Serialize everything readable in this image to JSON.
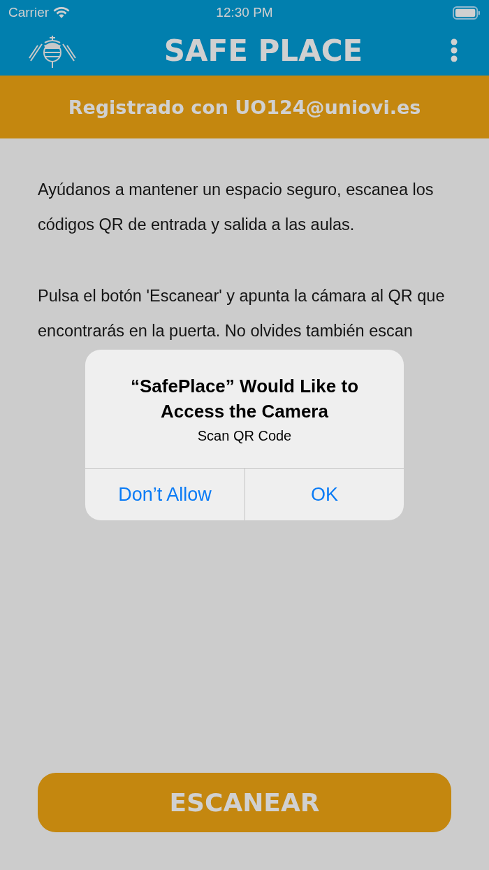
{
  "status_bar": {
    "carrier": "Carrier",
    "time": "12:30 PM"
  },
  "app_bar": {
    "title": "SAFE PLACE"
  },
  "banner": {
    "text": "Registrado con UO124@uniovi.es"
  },
  "paragraphs": [
    "Ayúdanos a mantener un espacio seguro, escanea los códigos QR de entrada y salida a las aulas.",
    "Pulsa el botón 'Escanear' y apunta la cámara al QR que encontrarás en la puerta. No olvides también escan"
  ],
  "scan_button": {
    "label": "ESCANEAR"
  },
  "alert": {
    "title": "“SafePlace” Would Like to Access the Camera",
    "message": "Scan QR Code",
    "buttons": [
      "Don’t Allow",
      "OK"
    ]
  }
}
